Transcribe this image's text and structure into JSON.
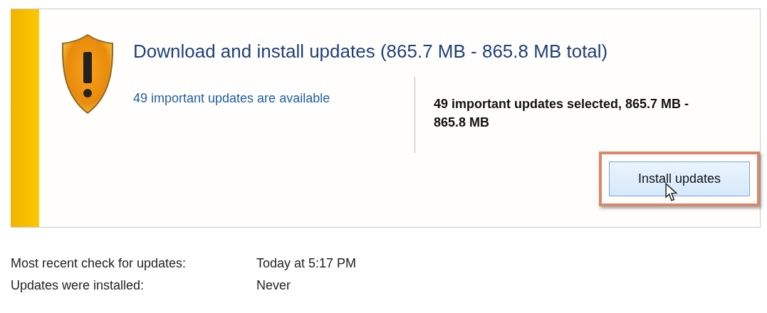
{
  "update_panel": {
    "title": "Download and install updates (865.7 MB - 865.8 MB total)",
    "available_link": "49 important updates are available",
    "selection_summary": "49 important updates selected, 865.7 MB - 865.8 MB",
    "install_button": {
      "label": "Install updates",
      "highlighted": true
    }
  },
  "status": [
    {
      "label": "Most recent check for updates:",
      "value": "Today at 5:17 PM"
    },
    {
      "label": "Updates were installed:",
      "value": "Never"
    }
  ]
}
